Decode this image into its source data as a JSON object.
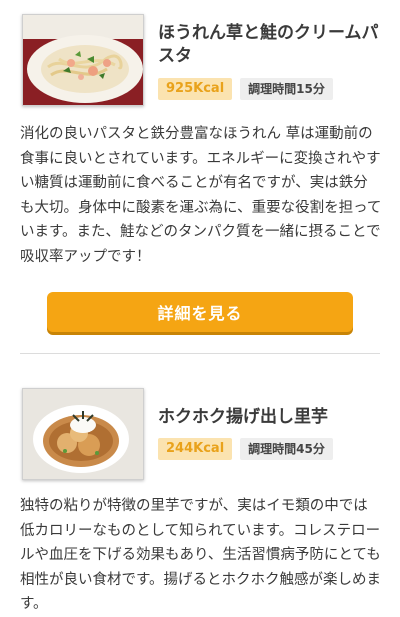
{
  "recipes": [
    {
      "title": "ほうれん草と鮭のクリームパスタ",
      "kcal": "925Kcal",
      "time": "調理時間15分",
      "description": "消化の良いパスタと鉄分豊富なほうれん 草は運動前の食事に良いとされています。エネルギーに変換されやすい糖質は運動前に食べることが有名ですが、実は鉄分も大切。身体中に酸素を運ぶ為に、重要な役割を担っています。また、鮭などのタンパク質を一緒に摂ることで吸収率アップです！",
      "button": "詳細を見る"
    },
    {
      "title": "ホクホク揚げ出し里芋",
      "kcal": "244Kcal",
      "time": "調理時間45分",
      "description": "独特の粘りが特徴の里芋ですが、実はイモ類の中では低カロリーなものとして知られています。コレステロールや血圧を下げる効果もあり、生活習慣病予防にとても相性が良い食材です。揚げるとホクホク触感が楽しめます。"
    }
  ]
}
